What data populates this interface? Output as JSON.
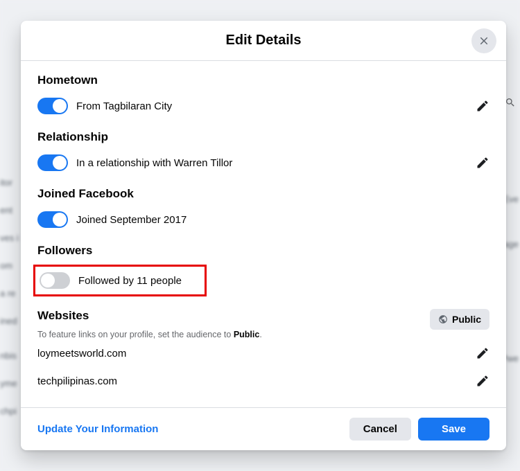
{
  "modal": {
    "title": "Edit Details",
    "update_link": "Update Your Information",
    "cancel": "Cancel",
    "save": "Save"
  },
  "sections": {
    "hometown": {
      "heading": "Hometown",
      "text": "From Tagbilaran City",
      "toggle_on": true
    },
    "relationship": {
      "heading": "Relationship",
      "text": "In a relationship with Warren Tillor",
      "toggle_on": true
    },
    "joined": {
      "heading": "Joined Facebook",
      "text": "Joined September 2017",
      "toggle_on": true
    },
    "followers": {
      "heading": "Followers",
      "text": "Followed by 11 people",
      "toggle_on": false
    },
    "websites": {
      "heading": "Websites",
      "subtext_prefix": "To feature links on your profile, set the audience to ",
      "subtext_bold": "Public",
      "public_label": "Public",
      "items": [
        "loymeetsworld.com",
        "techpilipinas.com"
      ]
    }
  },
  "bg_fragments": [
    "itor",
    "ent",
    "ves i",
    "om",
    "a re",
    "ined",
    "nbis",
    "yme",
    "chpi",
    "Eve",
    "age",
    "Pwe"
  ]
}
